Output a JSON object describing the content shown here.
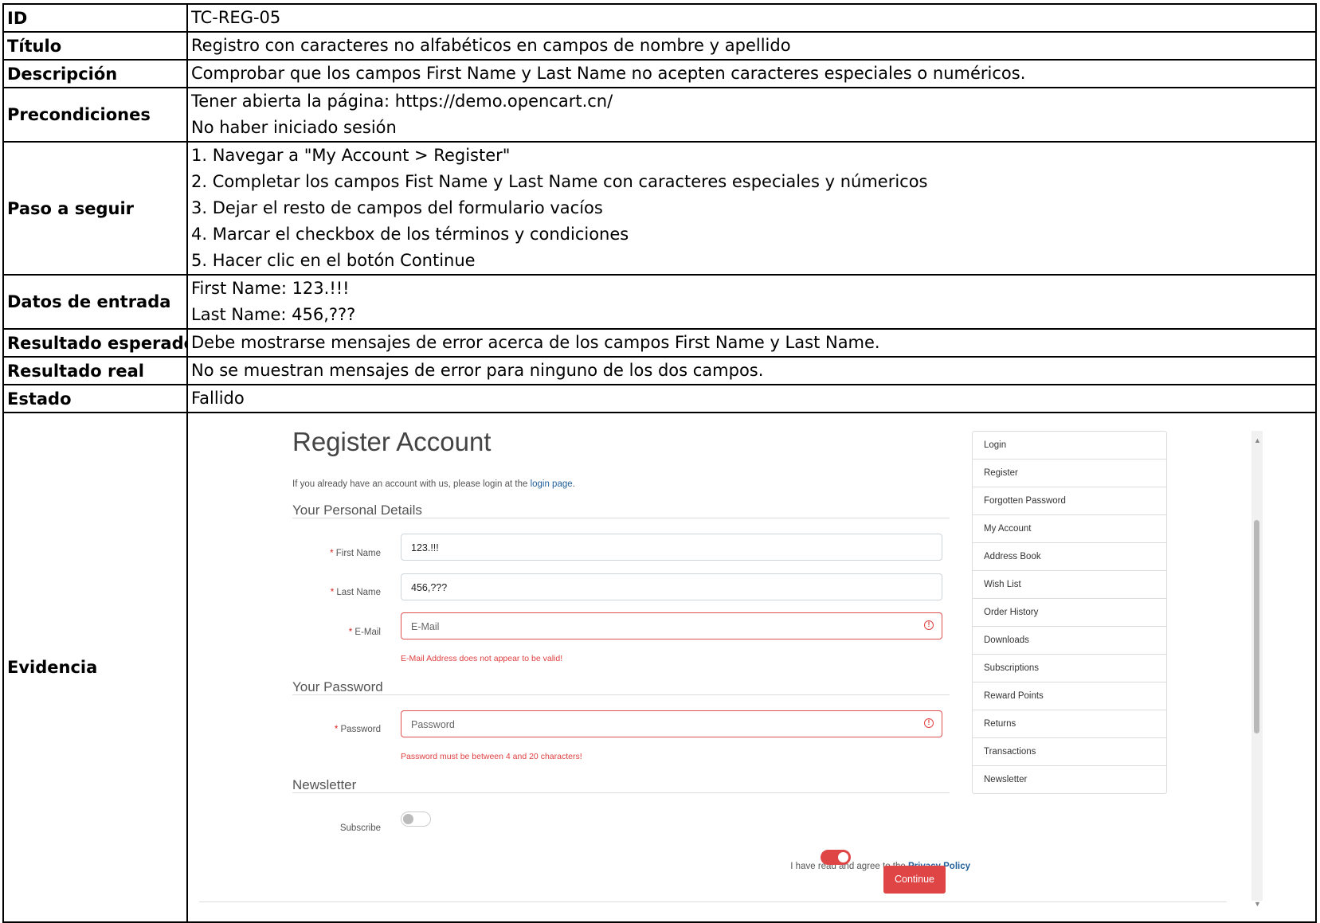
{
  "rows": [
    {
      "key": "ID",
      "lines": [
        "TC-REG-05"
      ]
    },
    {
      "key": "Título",
      "lines": [
        "Registro con caracteres no alfabéticos en campos de nombre y apellido"
      ]
    },
    {
      "key": "Descripción",
      "lines": [
        "Comprobar que los campos First Name y Last Name no acepten caracteres especiales o numéricos."
      ]
    },
    {
      "key": "Precondiciones",
      "lines": [
        "Tener abierta la página: https://demo.opencart.cn/",
        "No haber iniciado sesión"
      ]
    },
    {
      "key": "Paso a seguir",
      "lines": [
        "1. Navegar a \"My Account > Register\"",
        "2. Completar los campos Fist Name y Last Name con caracteres especiales y númericos",
        "3. Dejar el resto de campos del formulario vacíos",
        "4. Marcar el checkbox de los términos y condiciones",
        "5. Hacer clic en el botón Continue"
      ]
    },
    {
      "key": "Datos de entrada",
      "lines": [
        "First Name: 123.!!!",
        "Last Name: 456,???"
      ]
    },
    {
      "key": "Resultado esperado",
      "lines": [
        "Debe mostrarse mensajes de error acerca de los campos First Name y Last Name."
      ]
    },
    {
      "key": "Resultado real",
      "lines": [
        "No se muestran mensajes de error para ninguno de los dos campos."
      ]
    },
    {
      "key": "Estado",
      "lines": [
        "Fallido"
      ]
    }
  ],
  "evidence": {
    "key": "Evidencia",
    "title": "Register Account",
    "subtitle_prefix": "If you already have an account with us, please login at the ",
    "subtitle_link": "login page",
    "subtitle_suffix": ".",
    "section_personal": "Your Personal Details",
    "section_password": "Your Password",
    "section_newsletter": "Newsletter",
    "required_mark": "*",
    "first_name_label": "First Name",
    "first_name_value": "123.!!!",
    "last_name_label": "Last Name",
    "last_name_value": "456,???",
    "email_label": "E-Mail",
    "email_placeholder": "E-Mail",
    "email_error": "E-Mail Address does not appear to be valid!",
    "password_label": "Password",
    "password_placeholder": "Password",
    "password_error": "Password must be between 4 and 20 characters!",
    "subscribe_label": "Subscribe",
    "agree_text": "I have read and agree to the ",
    "agree_link": "Privacy Policy",
    "continue_label": "Continue",
    "menu": [
      "Login",
      "Register",
      "Forgotten Password",
      "My Account",
      "Address Book",
      "Wish List",
      "Order History",
      "Downloads",
      "Subscriptions",
      "Reward Points",
      "Returns",
      "Transactions",
      "Newsletter"
    ],
    "colors": {
      "accent": "#e04545",
      "link": "#1f5f9a"
    }
  }
}
